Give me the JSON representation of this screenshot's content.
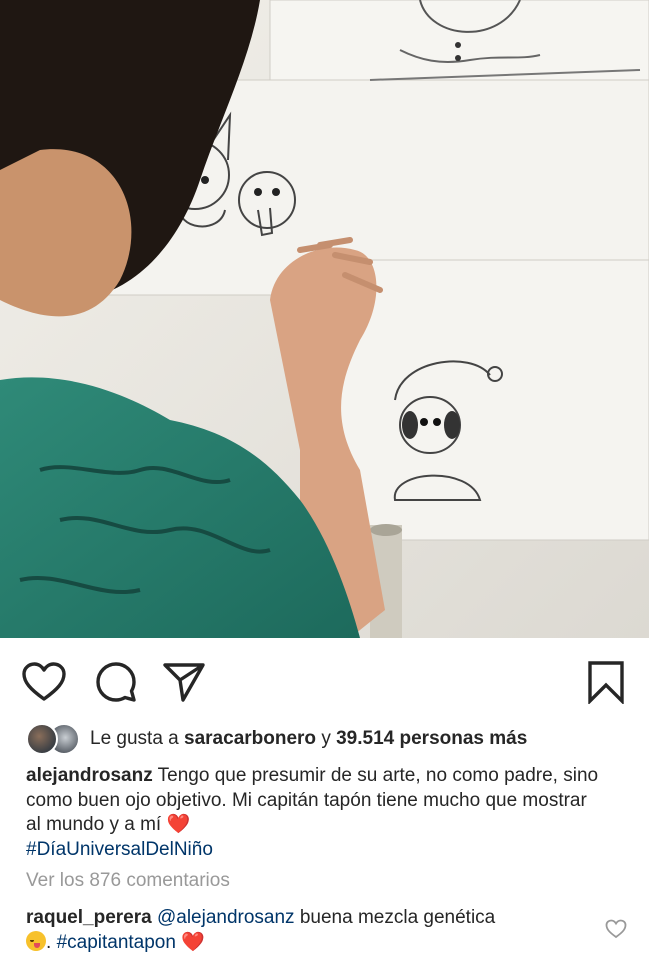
{
  "post": {
    "photo_alt": "photo"
  },
  "likes": {
    "prefix": "Le gusta a ",
    "user": "saracarbonero",
    "conj": " y ",
    "count_text": "39.514 personas más"
  },
  "caption": {
    "username": "alejandrosanz",
    "text": "Tengo que presumir de su arte, no como padre, sino como buen ojo objetivo. Mi capitán tapón tiene mucho que mostrar al mundo y a mí",
    "heart": "❤️",
    "hashtag": "#DíaUniversalDelNiño"
  },
  "comments": {
    "view_all": "Ver los 876 comentarios",
    "items": [
      {
        "username": "raquel_perera",
        "mention": "@alejandrosanz",
        "text_before": " buena mezcla genética",
        "text_mid": ". ",
        "hashtag": "#capitantapon",
        "heart": "❤️"
      }
    ]
  },
  "icons": [
    "heart-icon",
    "comment-icon",
    "share-icon",
    "bookmark-icon",
    "comment-like-heart-icon"
  ],
  "colors": {
    "text": "#262626",
    "muted": "#999999",
    "link": "#003569",
    "heart": "#e0245e"
  }
}
